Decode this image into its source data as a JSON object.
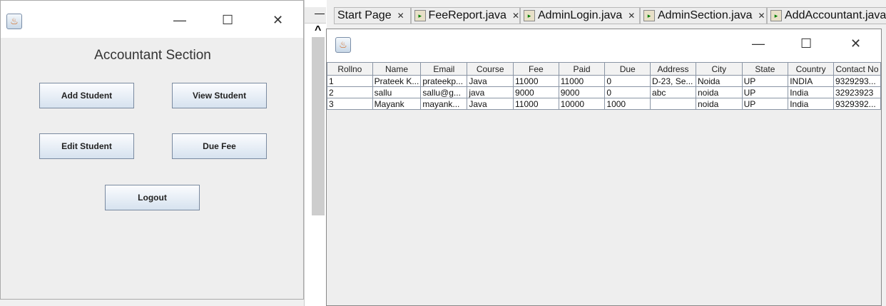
{
  "accountant_window": {
    "title": "Accountant Section",
    "buttons": {
      "add": "Add Student",
      "view": "View Student",
      "edit": "Edit Student",
      "due": "Due Fee",
      "logout": "Logout"
    }
  },
  "ide": {
    "tabs": [
      "Start Page",
      "FeeReport.java",
      "AdminLogin.java",
      "AdminSection.java",
      "AddAccountant.java"
    ],
    "minimize": "—",
    "scroll_up": "^"
  },
  "window_controls": {
    "minimize": "—",
    "maximize": "☐",
    "close": "✕"
  },
  "table": {
    "headers": [
      "Rollno",
      "Name",
      "Email",
      "Course",
      "Fee",
      "Paid",
      "Due",
      "Address",
      "City",
      "State",
      "Country",
      "Contact No"
    ],
    "rows": [
      [
        "1",
        "Prateek K...",
        "prateekp...",
        "Java",
        "11000",
        "11000",
        "0",
        "D-23, Se...",
        "Noida",
        "UP",
        "INDIA",
        "9329293..."
      ],
      [
        "2",
        "sallu",
        "sallu@g...",
        "java",
        "9000",
        "9000",
        "0",
        "abc",
        "noida",
        "UP",
        "India",
        "32923923"
      ],
      [
        "3",
        "Mayank",
        "mayank...",
        "Java",
        "11000",
        "10000",
        "1000",
        "",
        "noida",
        "UP",
        "India",
        "9329392..."
      ]
    ]
  }
}
